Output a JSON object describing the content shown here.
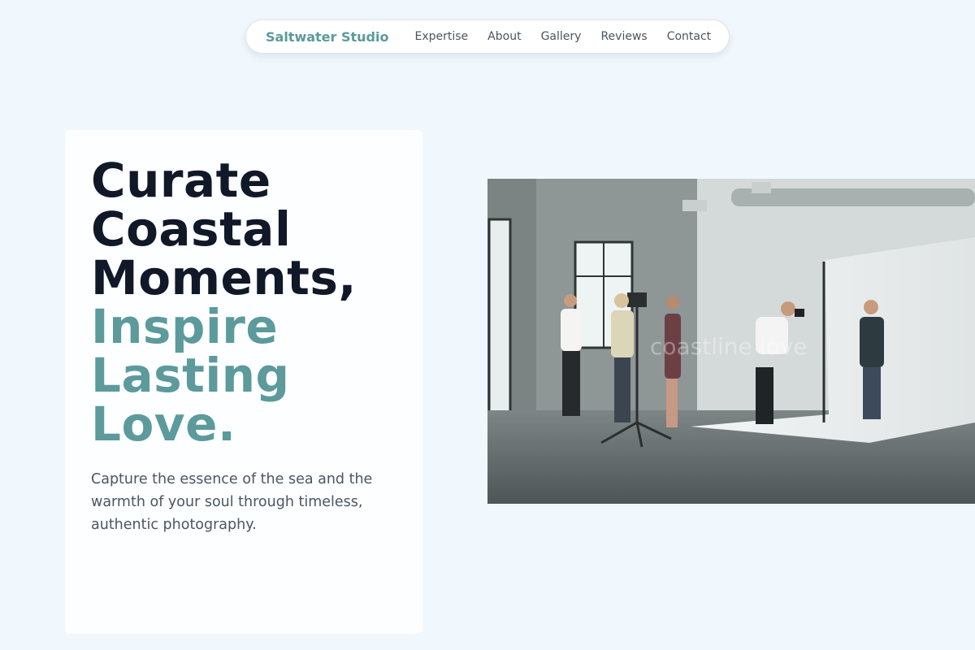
{
  "nav": {
    "brand": "Saltwater Studio",
    "links": [
      {
        "label": "Expertise"
      },
      {
        "label": "About"
      },
      {
        "label": "Gallery"
      },
      {
        "label": "Reviews"
      },
      {
        "label": "Contact"
      }
    ]
  },
  "hero": {
    "headline_lines": [
      "Curate",
      "Coastal",
      "Moments,"
    ],
    "accent_lines": [
      "Inspire",
      "Lasting",
      "Love."
    ],
    "subtext": "Capture the essence of the sea and the warmth of your soul through timeless, authentic photography.",
    "image_overlay": "coastline love"
  },
  "colors": {
    "background": "#f1f8fd",
    "brand": "#5a9a9e",
    "headline": "#111827",
    "accent": "#5c9a9c",
    "body_text": "#4b5563"
  },
  "icons": {
    "photo": "studio-photoshoot-image"
  }
}
